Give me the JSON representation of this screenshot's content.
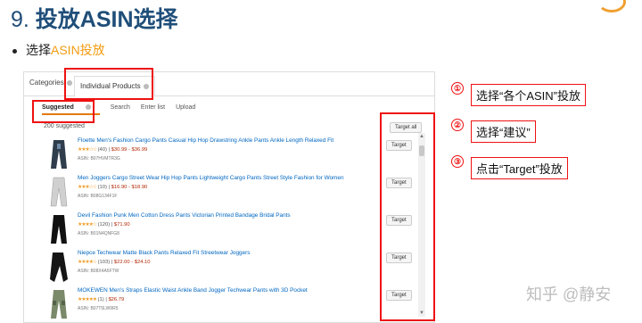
{
  "slide": {
    "title_num": "9. ",
    "title_text": "投放ASIN选择",
    "bullet_prefix": "选择",
    "bullet_hl": "ASIN投放"
  },
  "ui": {
    "tabs": [
      "Categories",
      "Individual Products"
    ],
    "subtabs": [
      "Suggested",
      "Search",
      "Enter list",
      "Upload"
    ],
    "count": "200 suggested",
    "target_all": "Target all",
    "target_label": "Target",
    "products": [
      {
        "title": "Floette Men's Fashion Cargo Pants Casual Hip Hop Drawstring Ankle Pants Ankle Length Relaxed Fit",
        "stars": "★★★☆☆",
        "reviews": "(40)",
        "price": "$30.99 - $36.99",
        "asin": "ASIN: B07HVMTR3G"
      },
      {
        "title": "Men Joggers Cargo Street Wear Hip Hop Pants Lightweight Cargo Pants Street Style Fashion for Women",
        "stars": "★★★☆☆",
        "reviews": "(10)",
        "price": "$16.90 - $18.90",
        "asin": "ASIN: B08G134F1F"
      },
      {
        "title": "Devil Fashion Punk Men Cotton Dress Pants Victorian Printed Bandage Bridal Pants",
        "stars": "★★★★☆",
        "reviews": "(120)",
        "price": "$71.90",
        "asin": "ASIN: B01N4QNFG8"
      },
      {
        "title": "Niepce Techwear Matte Black Pants Relaxed Fit Streetwear Joggers",
        "stars": "★★★★☆",
        "reviews": "(103)",
        "price": "$22.00 - $24.10",
        "asin": "ASIN: B08X4A5FTW"
      },
      {
        "title": "MOKEWEN Men's Straps Elastic Waist Ankle Band Jogger Techwear Pants with 3D Pocket",
        "stars": "★★★★★",
        "reviews": "(1)",
        "price": "$26.79",
        "asin": "ASIN: B07T5LW9R5"
      }
    ]
  },
  "callouts": [
    {
      "num": "①",
      "text": "选择“各个ASIN”投放"
    },
    {
      "num": "②",
      "text": "选择“建议”"
    },
    {
      "num": "③",
      "text": "点击“Target”投放"
    }
  ],
  "watermark": "知乎 @静安"
}
